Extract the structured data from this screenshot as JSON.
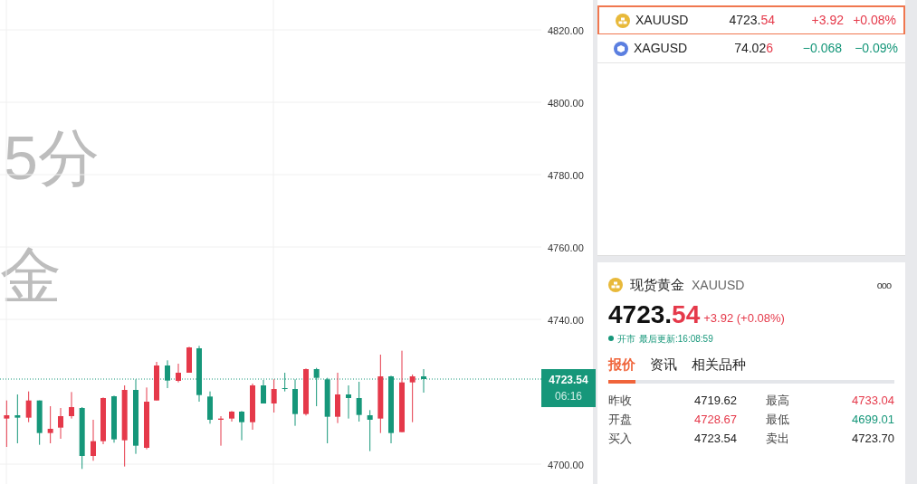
{
  "chart": {
    "watermark": [
      "5分",
      "金"
    ],
    "price_axis": [
      "4820.00",
      "4800.00",
      "4780.00",
      "4760.00",
      "4740.00",
      "4700.00"
    ],
    "current_price_tag": {
      "price": "4723.54",
      "countdown": "06:16"
    }
  },
  "watchlist": [
    {
      "symbol": "XAUUSD",
      "kind": "gold",
      "price_main": "4723.",
      "price_tail": "54",
      "change": "+3.92",
      "change_pct": "+0.08%",
      "color": "#e5394a",
      "selected": true
    },
    {
      "symbol": "XAGUSD",
      "kind": "silver",
      "price_main": "74.02",
      "price_tail": "6",
      "change": "−0.068",
      "change_pct": "−0.09%",
      "color": "#16977a",
      "selected": false
    }
  ],
  "detail": {
    "name": "现货黄金",
    "symbol": "XAUUSD",
    "price_main": "4723.",
    "price_tail": "54",
    "change": "+3.92 (+0.08%)",
    "color": "#e5394a",
    "market_status": "开市",
    "last_update": "最后更新:16:08:59",
    "more": "ooo",
    "tabs": [
      {
        "label": "报价",
        "selected": true
      },
      {
        "label": "资讯",
        "selected": false
      },
      {
        "label": "相关品种",
        "selected": false
      }
    ],
    "stats": [
      {
        "label": "昨收",
        "value": "4719.62",
        "color": "#222222"
      },
      {
        "label": "最高",
        "value": "4733.04",
        "color": "#e5394a"
      },
      {
        "label": "开盘",
        "value": "4728.67",
        "color": "#e5394a"
      },
      {
        "label": "最低",
        "value": "4699.01",
        "color": "#16977a"
      },
      {
        "label": "买入",
        "value": "4723.54",
        "color": "#222222"
      },
      {
        "label": "卖出",
        "value": "4723.70",
        "color": "#222222"
      }
    ]
  }
}
